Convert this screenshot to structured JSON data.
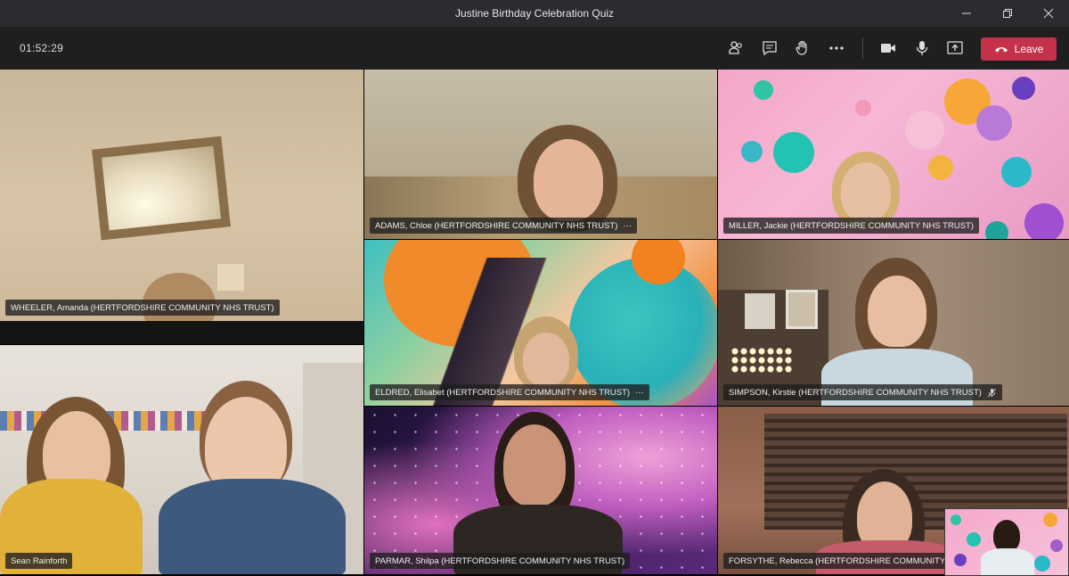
{
  "window": {
    "title": "Justine Birthday Celebration Quiz",
    "minimize_icon": "minimize-icon",
    "restore_icon": "restore-icon",
    "close_icon": "close-icon"
  },
  "toolbar": {
    "timer": "01:52:29",
    "leave_label": "Leave",
    "icons": [
      "participants-icon",
      "chat-icon",
      "raise-hand-icon",
      "more-options-icon",
      "camera-icon",
      "microphone-icon",
      "share-screen-icon",
      "hang-up-icon"
    ],
    "leave_color": "#c4314b"
  },
  "participants": [
    {
      "name": "WHEELER, Amanda (HERTFORDSHIRE COMMUNITY NHS TRUST)",
      "more": "",
      "mic": ""
    },
    {
      "name": "ADAMS, Chloe (HERTFORDSHIRE COMMUNITY NHS TRUST)",
      "more": "···",
      "mic": ""
    },
    {
      "name": "MILLER, Jackie (HERTFORDSHIRE COMMUNITY NHS TRUST)",
      "more": "",
      "mic": ""
    },
    {
      "name": "ELDRED, Elisabet (HERTFORDSHIRE COMMUNITY NHS TRUST)",
      "more": "···",
      "mic": ""
    },
    {
      "name": "SIMPSON, Kirstie (HERTFORDSHIRE COMMUNITY NHS TRUST)",
      "more": "",
      "mic": "microphone-icon"
    },
    {
      "name": "Sean Rainforth",
      "more": "",
      "mic": ""
    },
    {
      "name": "PARMAR, Shilpa (HERTFORDSHIRE COMMUNITY NHS TRUST)",
      "more": "",
      "mic": ""
    },
    {
      "name": "FORSYTHE, Rebecca (HERTFORDSHIRE COMMUNITY NHS TRUST)",
      "more": "",
      "mic": ""
    }
  ]
}
